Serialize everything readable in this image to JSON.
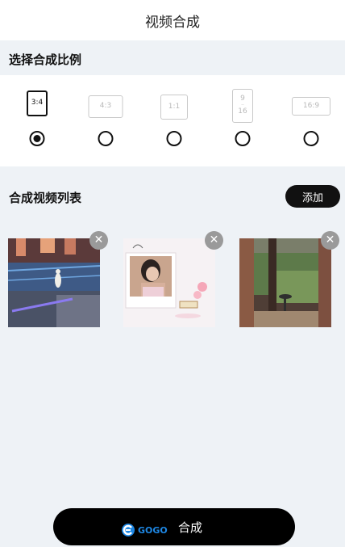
{
  "header": {
    "title": "视频合成"
  },
  "ratio_section": {
    "title": "选择合成比例",
    "options": [
      {
        "label": "3:4",
        "selected": true
      },
      {
        "label": "4:3",
        "selected": false
      },
      {
        "label": "1:1",
        "selected": false
      },
      {
        "label_top": "9",
        "label_bottom": "16",
        "selected": false
      },
      {
        "label": "16:9",
        "selected": false
      }
    ]
  },
  "video_section": {
    "title": "合成视频列表",
    "add_label": "添加",
    "close_glyph": "✕"
  },
  "footer": {
    "compose_label": "合成",
    "watermark_text": "GOGO"
  },
  "colors": {
    "accent": "#111111",
    "page_background": "#eef2f6",
    "panel_background": "#ffffff",
    "close_badge": "#9a9a9a"
  }
}
